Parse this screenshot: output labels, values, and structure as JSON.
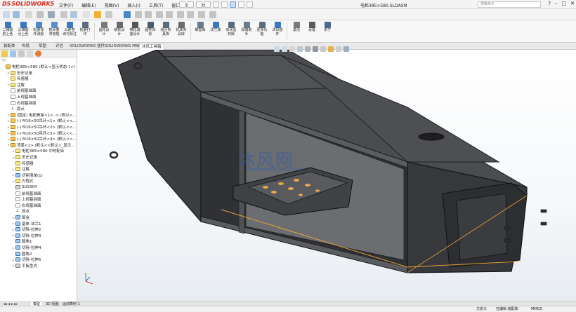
{
  "app": {
    "brand_prefix": "DS",
    "brand_name": "SOLIDWORKS"
  },
  "menu": [
    "文件(F)",
    "编辑(E)",
    "视图(V)",
    "插入(I)",
    "工具(T)",
    "窗口(W)",
    "帮助(H)"
  ],
  "document_title": "电柜385×580.SLDASM",
  "search_placeholder": "搜索命令",
  "ribbon": [
    {
      "label": "二维图\n层上色",
      "icon": "layer-color-icon"
    },
    {
      "label": "三维图\n引上色",
      "icon": "3d-color-icon"
    },
    {
      "label": "批量零\n件改颜",
      "icon": "batch-color-icon"
    },
    {
      "label": "技术要\n求管理",
      "icon": "tech-req-icon"
    },
    {
      "label": "公差查\n询与标注",
      "icon": "tolerance-icon"
    },
    {
      "label": "批量打\n印",
      "icon": "print-icon"
    },
    {
      "label": "齿轮设\n计",
      "icon": "gear-icon"
    },
    {
      "label": "链轮设\n计",
      "icon": "sprocket-icon"
    },
    {
      "label": "带轮减\n重设计",
      "icon": "pulley-icon"
    },
    {
      "label": "圆柱体\n标",
      "icon": "cylinder-icon"
    },
    {
      "label": "组合夹\n具库",
      "icon": "fixture-icon"
    },
    {
      "label": "机床夹\n具库",
      "icon": "machine-fixture-icon"
    },
    {
      "label": "螺塑库",
      "icon": "screw-lib-icon"
    },
    {
      "label": "法兰库",
      "icon": "flange-lib-icon"
    },
    {
      "label": "石化型\n材库",
      "icon": "profile-lib-icon"
    },
    {
      "label": "焊接助\n手",
      "icon": "weld-icon"
    },
    {
      "label": "更多功\n能",
      "icon": "more-icon"
    },
    {
      "label": "沐风插\n件",
      "icon": "plugin-icon"
    },
    {
      "label": "激活",
      "icon": "activate-icon"
    },
    {
      "label": "设置",
      "icon": "settings-icon"
    },
    {
      "label": "关于",
      "icon": "about-icon"
    }
  ],
  "tabs": [
    "装配体",
    "布局",
    "草图",
    "评估",
    "SOLIDWORKS 插件",
    "SOLIDWORKS MBD",
    "沐风工具箱"
  ],
  "active_tab": "沐风工具箱",
  "tree": [
    {
      "label": "电柜385×580 (默认<显示状态-1>)",
      "indent": 0,
      "arrow": "",
      "icon": "asm"
    },
    {
      "label": "历史记录",
      "indent": 1,
      "arrow": "▸",
      "icon": "fld"
    },
    {
      "label": "传感器",
      "indent": 1,
      "arrow": "",
      "icon": "fld"
    },
    {
      "label": "注解",
      "indent": 1,
      "arrow": "▸",
      "icon": "fld"
    },
    {
      "label": "前视基准面",
      "indent": 1,
      "arrow": "",
      "icon": "pln"
    },
    {
      "label": "上视基准面",
      "indent": 1,
      "arrow": "",
      "icon": "pln"
    },
    {
      "label": "右视基准面",
      "indent": 1,
      "arrow": "",
      "icon": "pln"
    },
    {
      "label": "原点",
      "indent": 1,
      "arrow": "",
      "icon": "org"
    },
    {
      "label": "(固定) 电柜骨架<1> -> (默认<...",
      "indent": 1,
      "arrow": "▸",
      "icon": "gold"
    },
    {
      "label": "(-) M16×50吊环<1> (默认<<...",
      "indent": 1,
      "arrow": "▸",
      "icon": "gold"
    },
    {
      "label": "(-) M16×50吊环<2> (默认<<...",
      "indent": 1,
      "arrow": "▸",
      "icon": "gold"
    },
    {
      "label": "(-) M16×50吊环<3> (默认<<...",
      "indent": 1,
      "arrow": "▸",
      "icon": "gold"
    },
    {
      "label": "(-) M16×50吊环<4> (默认<<...",
      "indent": 1,
      "arrow": "▸",
      "icon": "gold"
    },
    {
      "label": "顶盖<1> (默认<<默认>_显示...",
      "indent": 1,
      "arrow": "▾",
      "icon": "gold"
    },
    {
      "label": "电柜385×580 中的配合",
      "indent": 2,
      "arrow": "▸",
      "icon": "fld"
    },
    {
      "label": "历史记录",
      "indent": 2,
      "arrow": "▸",
      "icon": "fld"
    },
    {
      "label": "传感器",
      "indent": 2,
      "arrow": "",
      "icon": "fld"
    },
    {
      "label": "注解",
      "indent": 2,
      "arrow": "▸",
      "icon": "fld"
    },
    {
      "label": "切割清单(1)",
      "indent": 2,
      "arrow": "▸",
      "icon": "blue"
    },
    {
      "label": "方程式",
      "indent": 2,
      "arrow": "▸",
      "icon": "fld"
    },
    {
      "label": "SUS304",
      "indent": 2,
      "arrow": "",
      "icon": "gray"
    },
    {
      "label": "前视基准面",
      "indent": 2,
      "arrow": "",
      "icon": "pln"
    },
    {
      "label": "上视基准面",
      "indent": 2,
      "arrow": "",
      "icon": "pln"
    },
    {
      "label": "右视基准面",
      "indent": 2,
      "arrow": "",
      "icon": "pln"
    },
    {
      "label": "原点",
      "indent": 2,
      "arrow": "",
      "icon": "org"
    },
    {
      "label": "钣金",
      "indent": 2,
      "arrow": "▸",
      "icon": "blue"
    },
    {
      "label": "基体-法兰1",
      "indent": 2,
      "arrow": "▸",
      "icon": "blue"
    },
    {
      "label": "切除-拉伸2",
      "indent": 2,
      "arrow": "▸",
      "icon": "blue"
    },
    {
      "label": "切除-拉伸3",
      "indent": 2,
      "arrow": "▸",
      "icon": "blue"
    },
    {
      "label": "圆角1",
      "indent": 2,
      "arrow": "",
      "icon": "blue"
    },
    {
      "label": "切除-拉伸4",
      "indent": 2,
      "arrow": "▸",
      "icon": "blue"
    },
    {
      "label": "圆角2",
      "indent": 2,
      "arrow": "",
      "icon": "blue"
    },
    {
      "label": "切除-拉伸5",
      "indent": 2,
      "arrow": "▸",
      "icon": "blue"
    },
    {
      "label": "平板型式",
      "indent": 2,
      "arrow": "▸",
      "icon": "gray"
    }
  ],
  "bottom_tabs": [
    "模型",
    "3D 视图",
    "运动算例 1"
  ],
  "status": {
    "left": "",
    "state": "欠定义",
    "mode": "在编辑 装配体",
    "units": "MMGS"
  },
  "watermark": {
    "main": "沐风网",
    "sub": "www.mfcad.com"
  },
  "colors": {
    "body": "#46484c",
    "panel": "#2f3134",
    "edge": "#1a1a1a",
    "highlight": "#e6a13a",
    "accent": "#3a78c3"
  }
}
